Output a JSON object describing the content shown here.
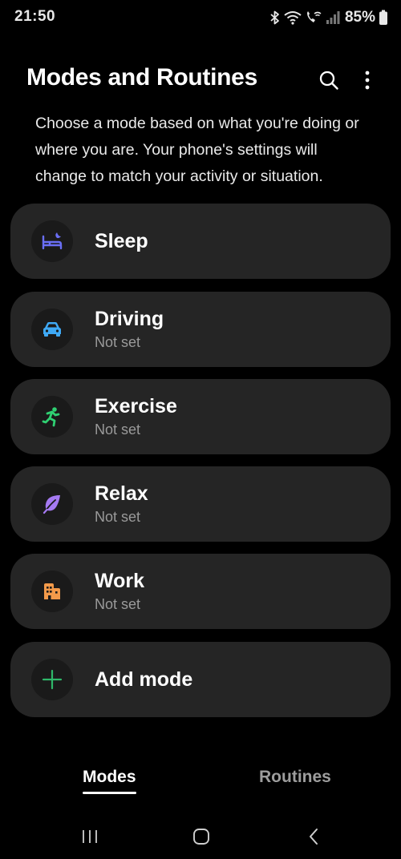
{
  "status_bar": {
    "time": "21:50",
    "battery": "85%",
    "icons": [
      "bluetooth-icon",
      "wifi-icon",
      "wifi-calling-icon",
      "signal-icon",
      "battery-icon"
    ]
  },
  "header": {
    "title": "Modes and Routines",
    "icons": [
      "search-icon",
      "more-vert-icon"
    ]
  },
  "description": "Choose a mode based on what you're doing or where you are. Your phone's settings will change to match your activity or situation.",
  "modes": [
    {
      "title": "Sleep",
      "subtitle": "",
      "icon": "bed-icon",
      "color": "#6a6ff5"
    },
    {
      "title": "Driving",
      "subtitle": "Not set",
      "icon": "car-icon",
      "color": "#3fa9f5"
    },
    {
      "title": "Exercise",
      "subtitle": "Not set",
      "icon": "running-icon",
      "color": "#2fd072"
    },
    {
      "title": "Relax",
      "subtitle": "Not set",
      "icon": "leaf-icon",
      "color": "#a57af2"
    },
    {
      "title": "Work",
      "subtitle": "Not set",
      "icon": "building-icon",
      "color": "#f39a4a"
    }
  ],
  "add_mode": {
    "label": "Add mode",
    "icon": "plus-icon",
    "color": "#2fb86a"
  },
  "tabs": [
    {
      "label": "Modes",
      "selected": true
    },
    {
      "label": "Routines",
      "selected": false
    }
  ],
  "nav_bar": [
    "recents-icon",
    "home-icon",
    "back-icon"
  ]
}
